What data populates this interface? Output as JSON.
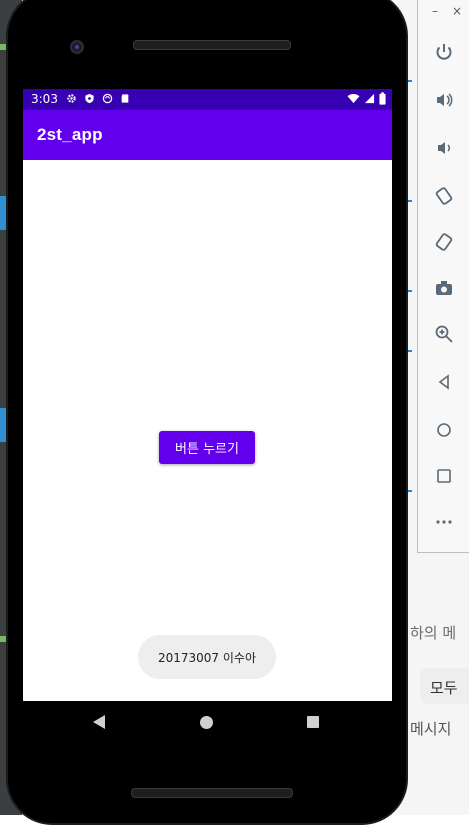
{
  "status_bar": {
    "time": "3:03",
    "icons": [
      "gear-icon",
      "shield-icon",
      "sync-icon",
      "sd-card-icon"
    ],
    "right_icons": [
      "wifi-icon",
      "signal-icon",
      "battery-icon"
    ]
  },
  "app": {
    "title": "2st_app",
    "button_label": "버튼 누르기",
    "toast_text": "20173007 이수아",
    "colors": {
      "primary": "#6200ee",
      "primary_dark": "#3700b3"
    }
  },
  "nav": {
    "back": "back-icon",
    "home": "home-icon",
    "recents": "recents-icon"
  },
  "emulator_toolbar": {
    "window_controls": [
      "–",
      "×"
    ],
    "tools": [
      "power-icon",
      "volume-up-icon",
      "volume-down-icon",
      "rotate-left-icon",
      "rotate-right-icon",
      "screenshot-icon",
      "zoom-icon",
      "back-icon",
      "home-icon",
      "overview-icon",
      "more-icon"
    ]
  },
  "host": {
    "text1": "하의 메",
    "chip": "모두",
    "text2": "메시지"
  }
}
